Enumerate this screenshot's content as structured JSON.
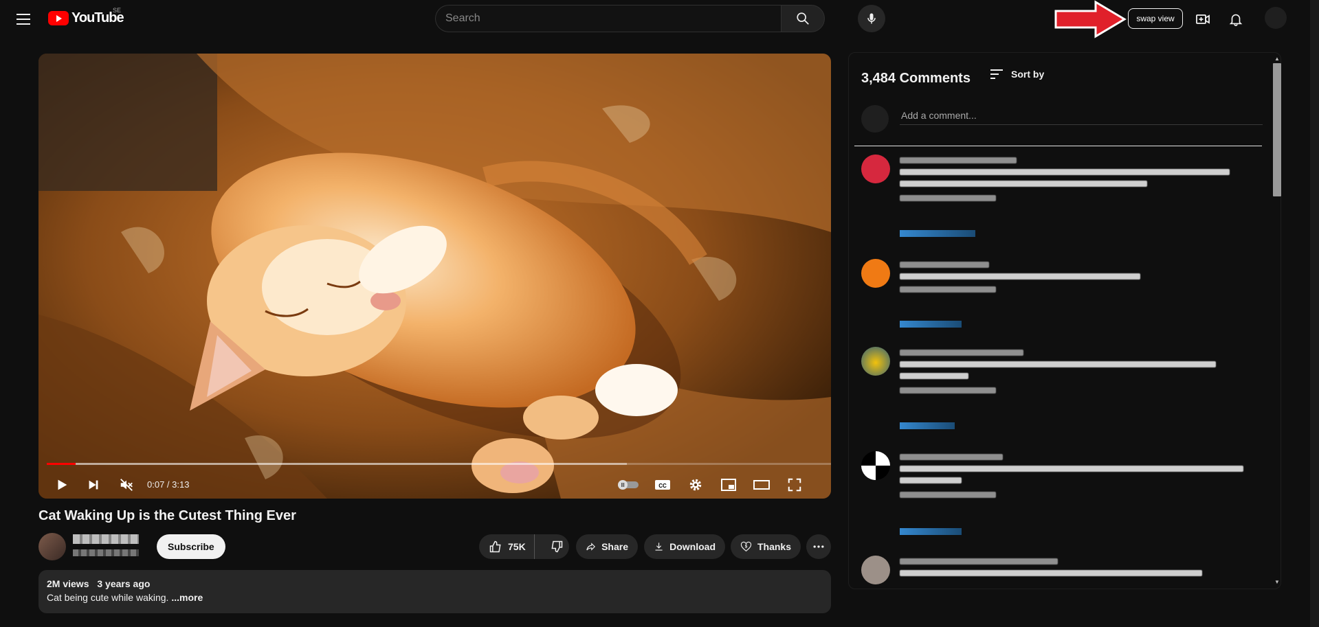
{
  "header": {
    "logo_text": "YouTube",
    "region": "SE",
    "search_placeholder": "Search",
    "swap_label": "swap view"
  },
  "player": {
    "current_time": "0:07",
    "duration": "3:13",
    "progress": 0.037,
    "buffered": 0.74
  },
  "video": {
    "title": "Cat Waking Up is the Cutest Thing Ever",
    "subscribe_label": "Subscribe",
    "likes": "75K",
    "share_label": "Share",
    "download_label": "Download",
    "thanks_label": "Thanks",
    "views": "2M views",
    "age": "3 years ago",
    "description": "Cat being cute while waking.",
    "more_label": "...more"
  },
  "comments": {
    "count_label": "3,484 Comments",
    "sort_label": "Sort by",
    "add_placeholder": "Add a comment..."
  },
  "colors": {
    "accent": "#ff0000",
    "background": "#0f0f0f",
    "surface": "#272727",
    "link_blue": "#3ea6ff",
    "annotation_arrow": "#e0202a"
  }
}
